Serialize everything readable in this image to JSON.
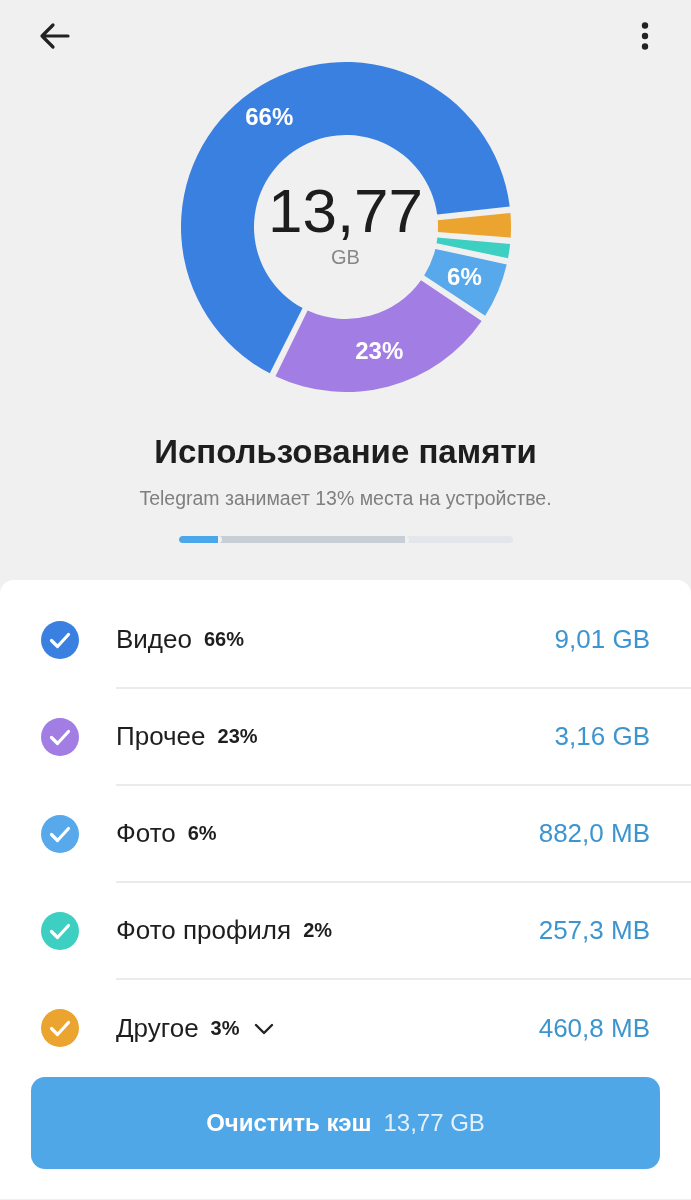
{
  "chart": {
    "total": "13,77",
    "unit": "GB",
    "chart_data": {
      "type": "donut",
      "values": [
        66,
        23,
        6,
        2,
        3
      ],
      "value_labels": [
        "66%",
        "23%",
        "6%",
        null,
        null
      ]
    }
  },
  "title": "Использование памяти",
  "subtitle": "Telegram занимает 13% места на устройстве.",
  "usage_bar": {
    "segments": [
      {
        "level": 0.13,
        "color": "#4aa8ea"
      },
      {
        "level": 0.69,
        "color": "#c8ced6"
      }
    ]
  },
  "categories": [
    {
      "kind": "item",
      "name": "Видео",
      "percent": "66%",
      "size": "9,01 GB",
      "checked": true,
      "color": "#3a80e0"
    },
    {
      "kind": "item",
      "name": "Прочее",
      "percent": "23%",
      "size": "3,16 GB",
      "checked": true,
      "color": "#a17de4"
    },
    {
      "kind": "item",
      "name": "Фото",
      "percent": "6%",
      "size": "882,0 MB",
      "checked": true,
      "color": "#58a8ec"
    },
    {
      "kind": "item",
      "name": "Фото профиля",
      "percent": "2%",
      "size": "257,3 MB",
      "checked": true,
      "color": "#3ccfc2"
    },
    {
      "kind": "group",
      "name": "Другое",
      "percent": "3%",
      "size": "460,8 MB",
      "checked": true,
      "color": "#eba42f"
    }
  ],
  "clear_button": {
    "label": "Очистить кэш",
    "size": "13,77 GB"
  }
}
